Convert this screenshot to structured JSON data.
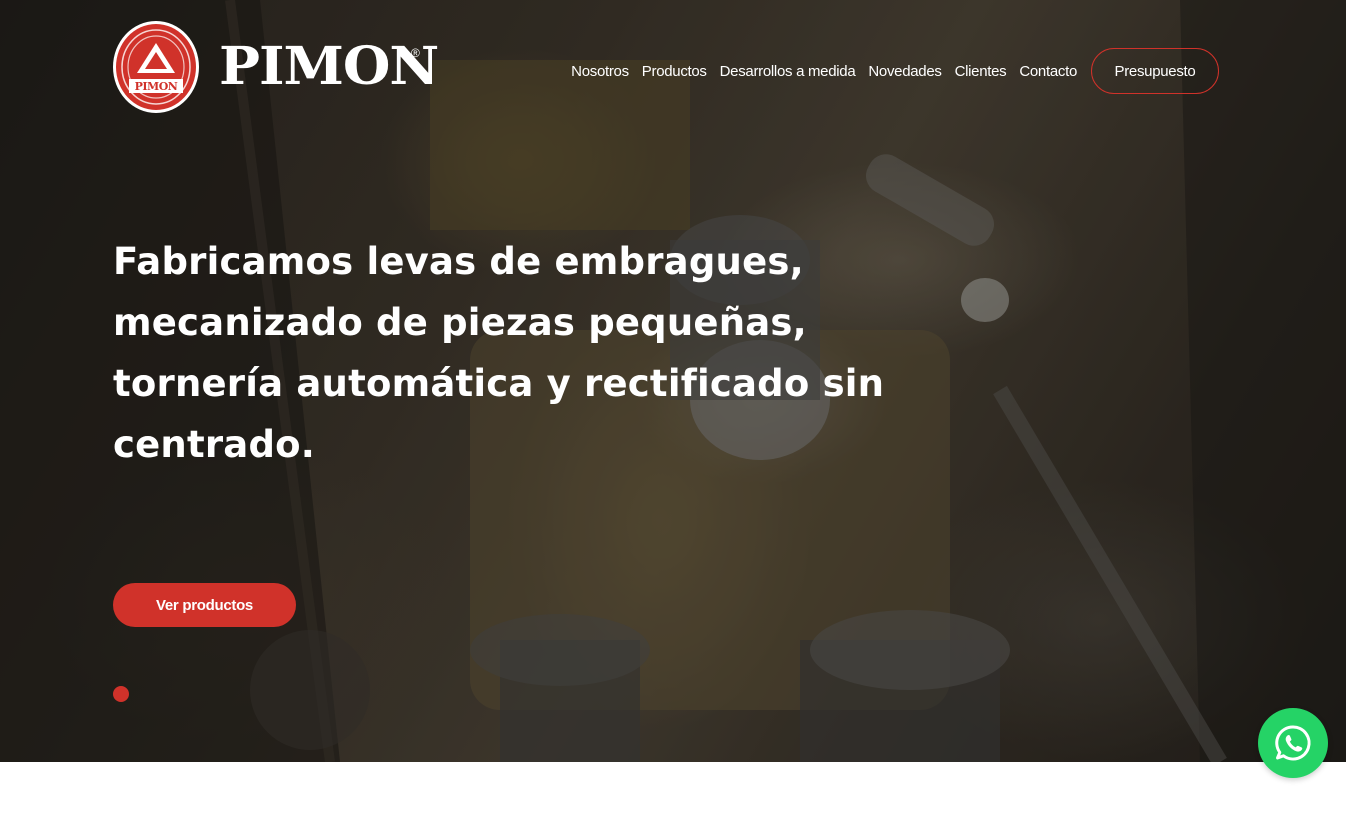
{
  "header": {
    "logo_badge_text": "PIMON",
    "logo_wordmark": "PIMON",
    "logo_registered": "®",
    "nav": [
      {
        "label": "Nosotros"
      },
      {
        "label": "Productos"
      },
      {
        "label": "Desarrollos a medida"
      },
      {
        "label": "Novedades"
      },
      {
        "label": "Clientes"
      },
      {
        "label": "Contacto"
      }
    ],
    "cta_label": "Presupuesto"
  },
  "hero": {
    "headline": "Fabricamos levas de embragues, mecanizado de piezas pequeñas, tornería automática y rectificado sin centrado.",
    "button_label": "Ver productos",
    "slider": {
      "active_index": 1,
      "total": 1
    }
  },
  "floating": {
    "whatsapp_icon": "whatsapp-icon"
  },
  "colors": {
    "accent": "#d0322a",
    "whatsapp": "#25d366",
    "text": "#ffffff"
  }
}
